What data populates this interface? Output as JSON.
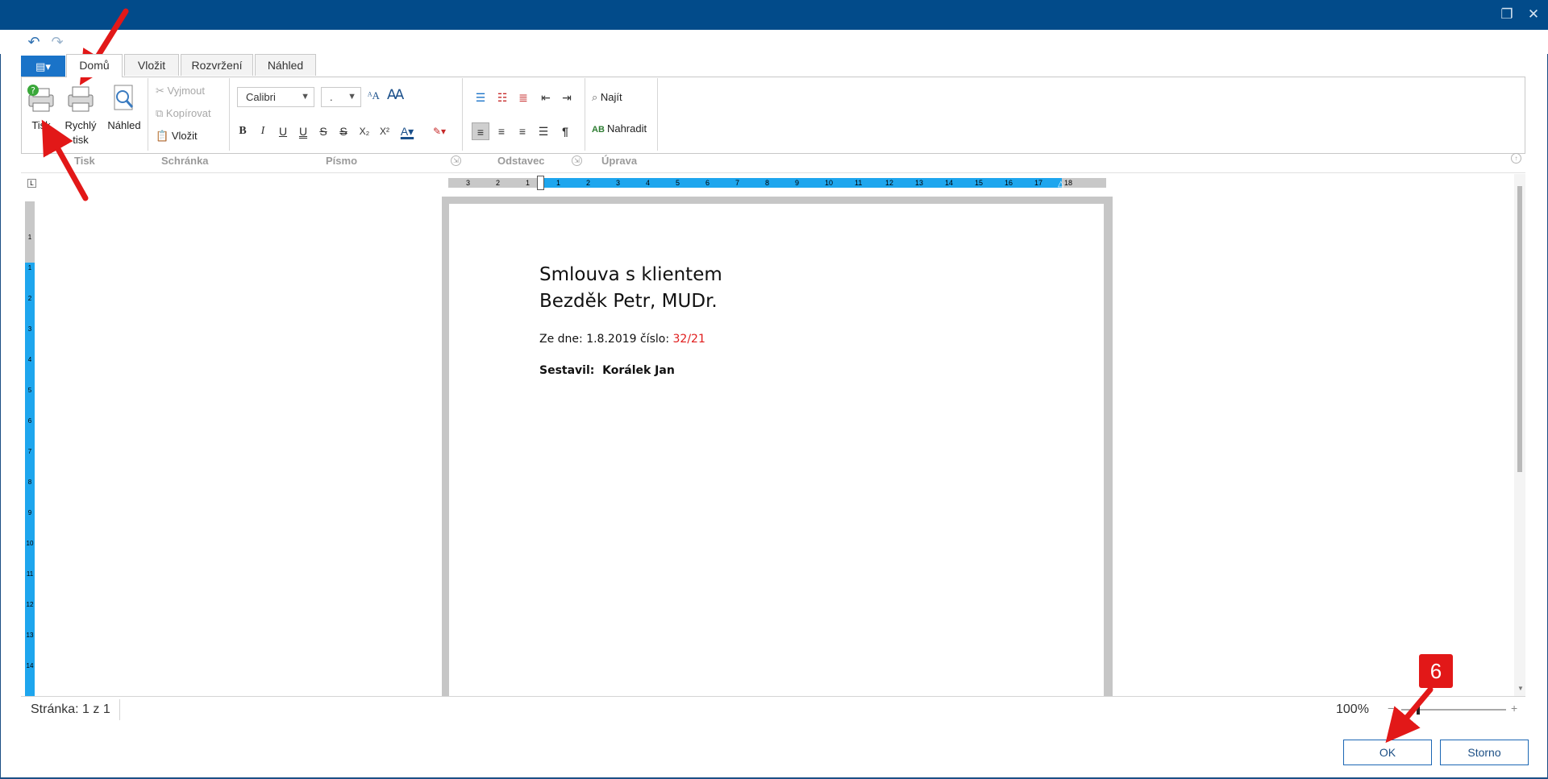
{
  "window": {
    "restore_icon": "restore-icon",
    "close_icon": "close-icon"
  },
  "quickbar": {
    "undo_icon": "undo-icon",
    "redo_icon": "redo-icon"
  },
  "tabs": [
    {
      "label": "Domů",
      "active": true
    },
    {
      "label": "Vložit"
    },
    {
      "label": "Rozvržení"
    },
    {
      "label": "Náhled"
    }
  ],
  "appmenu": {
    "icon": "document-menu-icon"
  },
  "ribbon": {
    "groups": {
      "print": "Tisk",
      "clipboard": "Schránka",
      "font": "Písmo",
      "paragraph": "Odstavec",
      "edit": "Úprava"
    },
    "print_btn": "Tisk",
    "quickprint_btn_line1": "Rychlý",
    "quickprint_btn_line2": "tisk",
    "preview_btn": "Náhled",
    "cut_btn": "Vyjmout",
    "copy_btn": "Kopírovat",
    "paste_btn": "Vložit",
    "font_name": "Calibri",
    "font_size": ".",
    "find_btn": "Najít",
    "replace_btn": "Nahradit"
  },
  "ruler": {
    "h_numbers": [
      "3",
      "2",
      "1",
      "1",
      "2",
      "3",
      "4",
      "5",
      "6",
      "7",
      "8",
      "9",
      "10",
      "11",
      "12",
      "13",
      "14",
      "15",
      "16",
      "17",
      "18"
    ],
    "v_numbers": [
      "1",
      "1",
      "2",
      "3",
      "4",
      "5",
      "6",
      "7",
      "8",
      "9",
      "10",
      "11",
      "12",
      "13",
      "14"
    ]
  },
  "document": {
    "title_line1": "Smlouva s klientem",
    "title_line2": "Bezděk Petr, MUDr.",
    "date_prefix": "Ze dne: 1.8.2019 číslo: ",
    "number": "32/21",
    "author_label": "Sestavil:",
    "author_name": "Korálek Jan"
  },
  "status": {
    "page": "Stránka: 1 z 1",
    "zoom": "100%",
    "zoom_level_percent": 100
  },
  "buttons": {
    "ok": "OK",
    "cancel": "Storno"
  },
  "annotation": {
    "badge": "6"
  },
  "colors": {
    "titlebar": "#024b8a",
    "ruler_active": "#1ea6ee",
    "annotation_red": "#e21818",
    "doc_number_red": "#e01b1b"
  }
}
